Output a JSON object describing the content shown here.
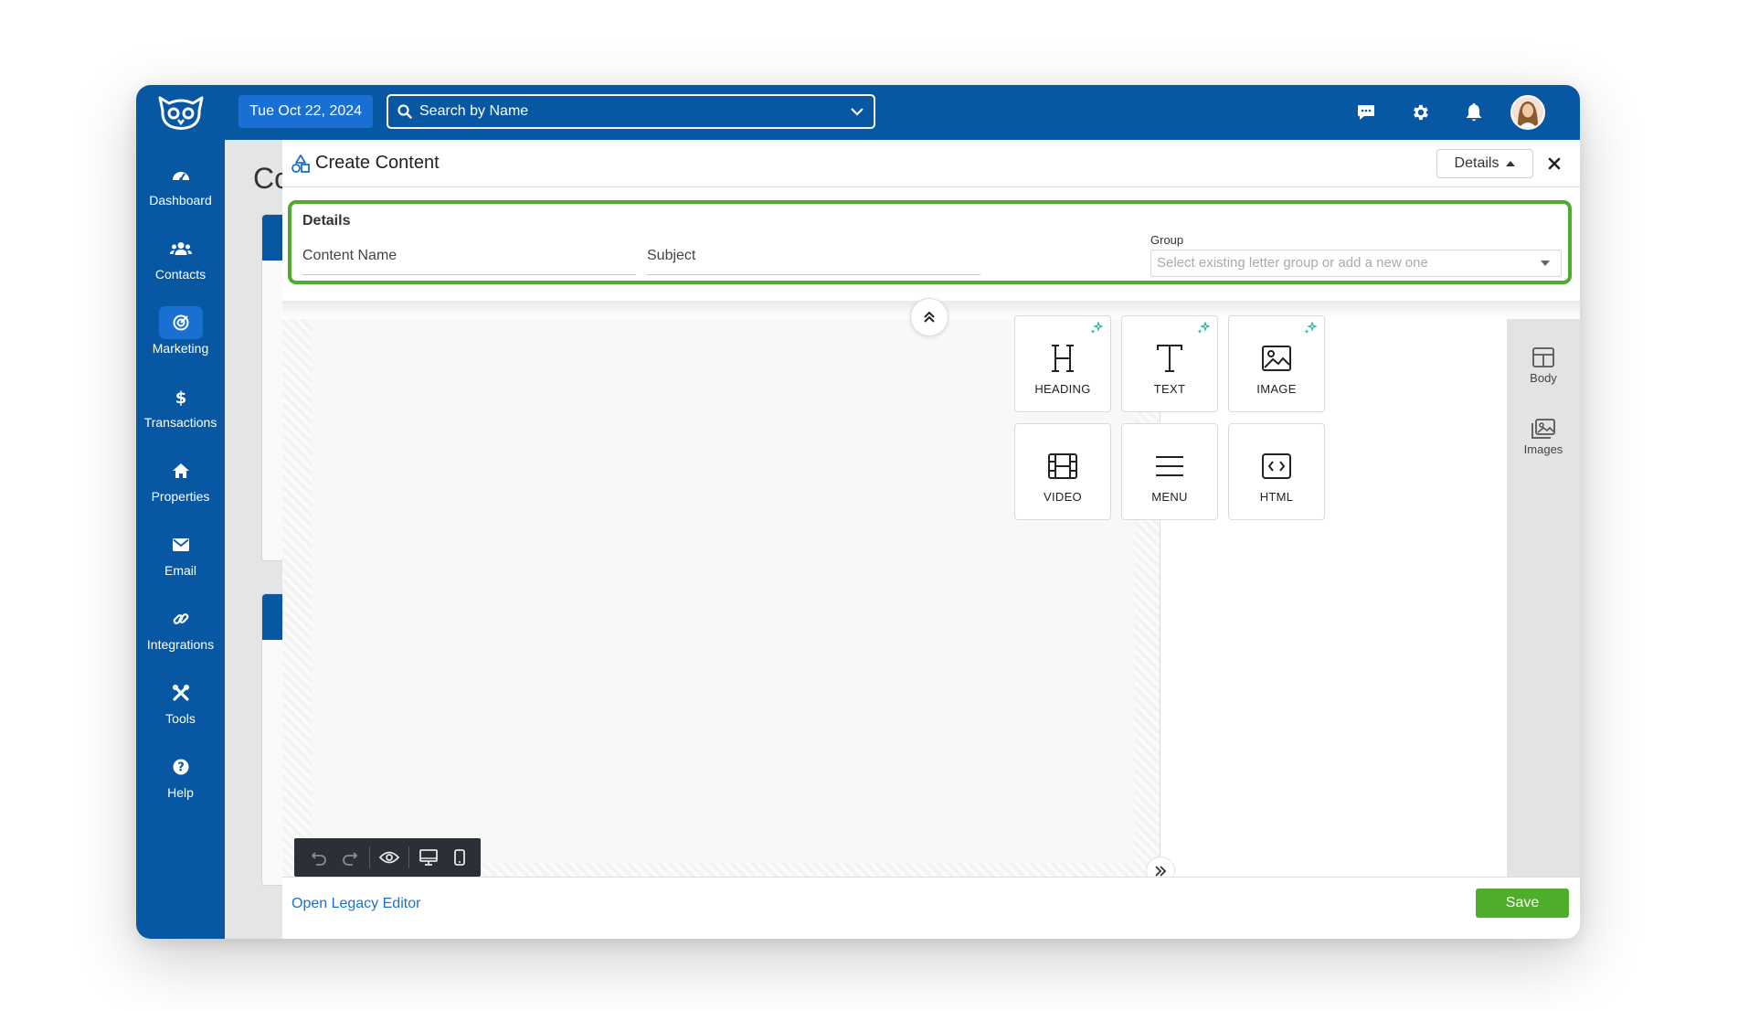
{
  "topbar": {
    "date": "Tue Oct 22, 2024",
    "search_placeholder": "Search by Name",
    "icons": [
      "chat-icon",
      "gear-icon",
      "bell-icon"
    ]
  },
  "sidebar": {
    "items": [
      {
        "label": "Dashboard",
        "icon": "dashboard-icon"
      },
      {
        "label": "Contacts",
        "icon": "users-icon"
      },
      {
        "label": "Marketing",
        "icon": "target-icon",
        "active": true
      },
      {
        "label": "Transactions",
        "icon": "dollar-icon"
      },
      {
        "label": "Properties",
        "icon": "home-icon"
      },
      {
        "label": "Email",
        "icon": "envelope-icon"
      },
      {
        "label": "Integrations",
        "icon": "link-icon"
      },
      {
        "label": "Tools",
        "icon": "tools-icon"
      },
      {
        "label": "Help",
        "icon": "question-icon"
      }
    ]
  },
  "background": {
    "title_fragment": "Co"
  },
  "modal": {
    "title": "Create Content",
    "details_button": "Details",
    "details": {
      "heading": "Details",
      "content_name_placeholder": "Content Name",
      "subject_placeholder": "Subject",
      "group_label": "Group",
      "group_placeholder": "Select existing letter group or add a new one"
    },
    "blocks": [
      {
        "label": "HEADING",
        "icon": "heading-icon",
        "ai": true
      },
      {
        "label": "TEXT",
        "icon": "text-icon",
        "ai": true
      },
      {
        "label": "IMAGE",
        "icon": "image-icon",
        "ai": true
      },
      {
        "label": "VIDEO",
        "icon": "video-icon",
        "ai": false
      },
      {
        "label": "MENU",
        "icon": "menu-icon",
        "ai": false
      },
      {
        "label": "HTML",
        "icon": "html-icon",
        "ai": false
      }
    ],
    "rail": [
      {
        "label": "Body",
        "icon": "layout-icon"
      },
      {
        "label": "Images",
        "icon": "images-icon"
      }
    ],
    "footer": {
      "legacy_link": "Open Legacy Editor",
      "save_button": "Save"
    }
  },
  "colors": {
    "brand_blue": "#0757a3",
    "accent_blue": "#1a6fd2",
    "highlight_green": "#4fad2c",
    "ai_sparkle": "#2bb3a3"
  }
}
